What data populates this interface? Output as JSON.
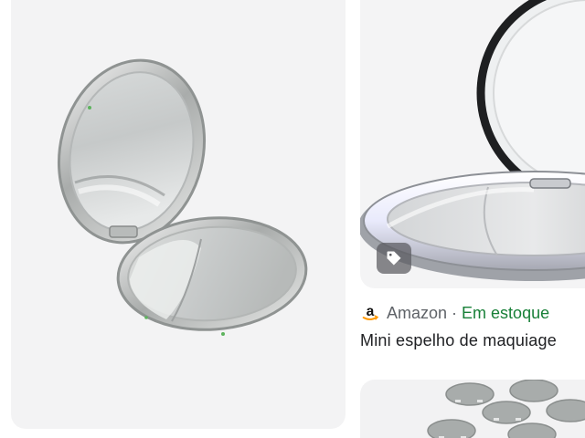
{
  "results": [
    {
      "image_label": "compact mirror silver open",
      "icon": "image"
    },
    {
      "image_label": "lighted compact mirror",
      "tag_icon": "tag-icon",
      "source_logo": "amazon-logo",
      "source": "Amazon",
      "separator": "·",
      "availability": "Em estoque",
      "title": "Mini espelho de maquiage"
    },
    {
      "image_label": "mirror blanks grey"
    }
  ],
  "colors": {
    "card_bg": "#f3f3f4",
    "availability_green": "#188038",
    "source_grey": "#5f6368",
    "title_dark": "#202124",
    "amazon_orange": "#ff9900"
  }
}
